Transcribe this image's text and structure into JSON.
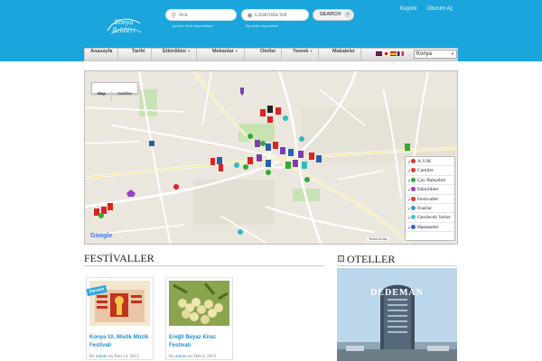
{
  "header": {
    "logo_text": "Konya Rehberi",
    "search_what_placeholder": "Ara",
    "search_what_hint": "yemek, ürün veya mekan",
    "search_where_placeholder": "Civarında bul",
    "search_where_hint": "Zip kodu veya adres",
    "search_button": "SEARCH",
    "register": "Kaydol",
    "login": "Oturum Aç"
  },
  "nav": {
    "items": [
      "Anasayfa",
      "Tarihi",
      "Etkinlikler",
      "Mekanlar",
      "Oteller",
      "Yemek",
      "Makaleler"
    ],
    "city": "Konya"
  },
  "map": {
    "toggle_map": "Map",
    "toggle_satellite": "Satellite",
    "google": "Google",
    "terms": "Terms of Use",
    "layers": [
      "A.V.M",
      "Camiler",
      "Çay Bahçeleri",
      "Etkinlikler",
      "Festivaller",
      "Fuarlar",
      "Gezilecek Yerler",
      "Hastaneler"
    ],
    "layer_colors": [
      "#d33",
      "#e33",
      "#3a3",
      "#9a3fc9",
      "#e33",
      "#39c",
      "#3cc",
      "#36c"
    ]
  },
  "festivals": {
    "title": "FESTİVALLER",
    "cards": [
      {
        "title": "Konya 10. Mistik Müzik Festivali",
        "author": "admin",
        "date": "Tem 14, 2013",
        "badge": "Devam"
      },
      {
        "title": "Ereğli Beyaz Kiraz Festivali",
        "author": "admin",
        "date": "Tem 6, 2013"
      }
    ],
    "by_label": "By",
    "on_label": "on"
  },
  "hotels": {
    "title": "OTELLER",
    "hotel_sign": "DEDEMAN"
  }
}
